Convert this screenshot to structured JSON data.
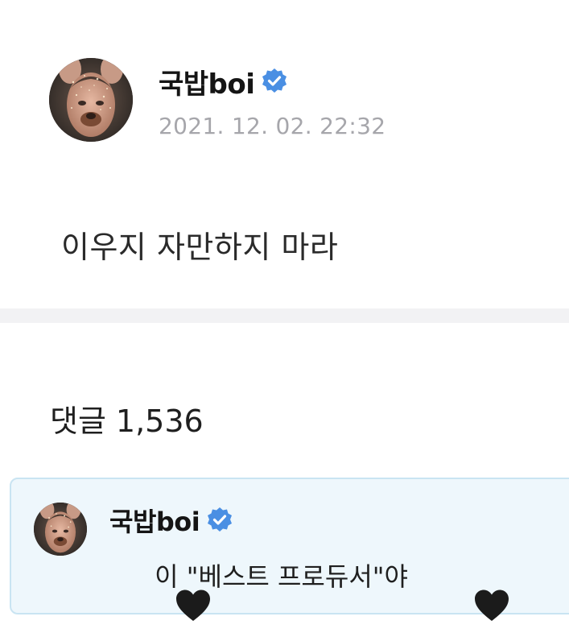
{
  "post": {
    "author": "국밥boi",
    "timestamp": "2021. 12. 02. 22:32",
    "body": "이우지 자만하지 마라"
  },
  "comments": {
    "label": "댓글",
    "count": "1,536",
    "best": {
      "author": "국밥boi",
      "text": " 이 \"베스트 프로듀서\"야",
      "emoji": "black-heart-icon"
    }
  },
  "colors": {
    "verified": "#4a8fe3",
    "card_bg": "#eef7fc",
    "card_border": "#c9e4f2",
    "timestamp": "#a6a6ab"
  }
}
